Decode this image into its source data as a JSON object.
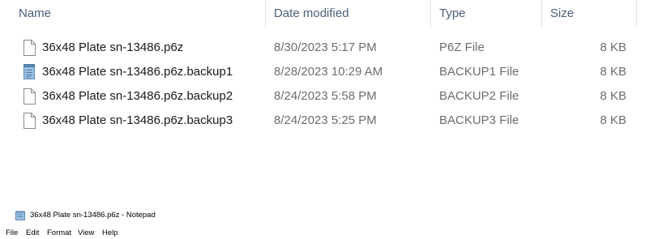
{
  "explorer": {
    "columns": {
      "name": "Name",
      "date_modified": "Date modified",
      "type": "Type",
      "size": "Size"
    },
    "files": [
      {
        "name": "36x48 Plate sn-13486.p6z",
        "date": "8/30/2023 5:17 PM",
        "type": "P6Z File",
        "size": "8 KB",
        "icon": "blank-document-icon"
      },
      {
        "name": "36x48 Plate sn-13486.p6z.backup1",
        "date": "8/28/2023 10:29 AM",
        "type": "BACKUP1 File",
        "size": "8 KB",
        "icon": "notepad-document-icon"
      },
      {
        "name": "36x48 Plate sn-13486.p6z.backup2",
        "date": "8/24/2023 5:58 PM",
        "type": "BACKUP2 File",
        "size": "8 KB",
        "icon": "blank-document-icon"
      },
      {
        "name": "36x48 Plate sn-13486.p6z.backup3",
        "date": "8/24/2023 5:25 PM",
        "type": "BACKUP3 File",
        "size": "8 KB",
        "icon": "blank-document-icon"
      }
    ]
  },
  "notepad": {
    "title": "36x48 Plate sn-13486.p6z - Notepad",
    "menu": [
      "File",
      "Edit",
      "Format",
      "View",
      "Help"
    ]
  },
  "colors": {
    "header_text": "#4c607a",
    "name_text": "#1a1a1a",
    "meta_text": "#6d6d6d",
    "notepad_icon": "#7fa6c9"
  }
}
